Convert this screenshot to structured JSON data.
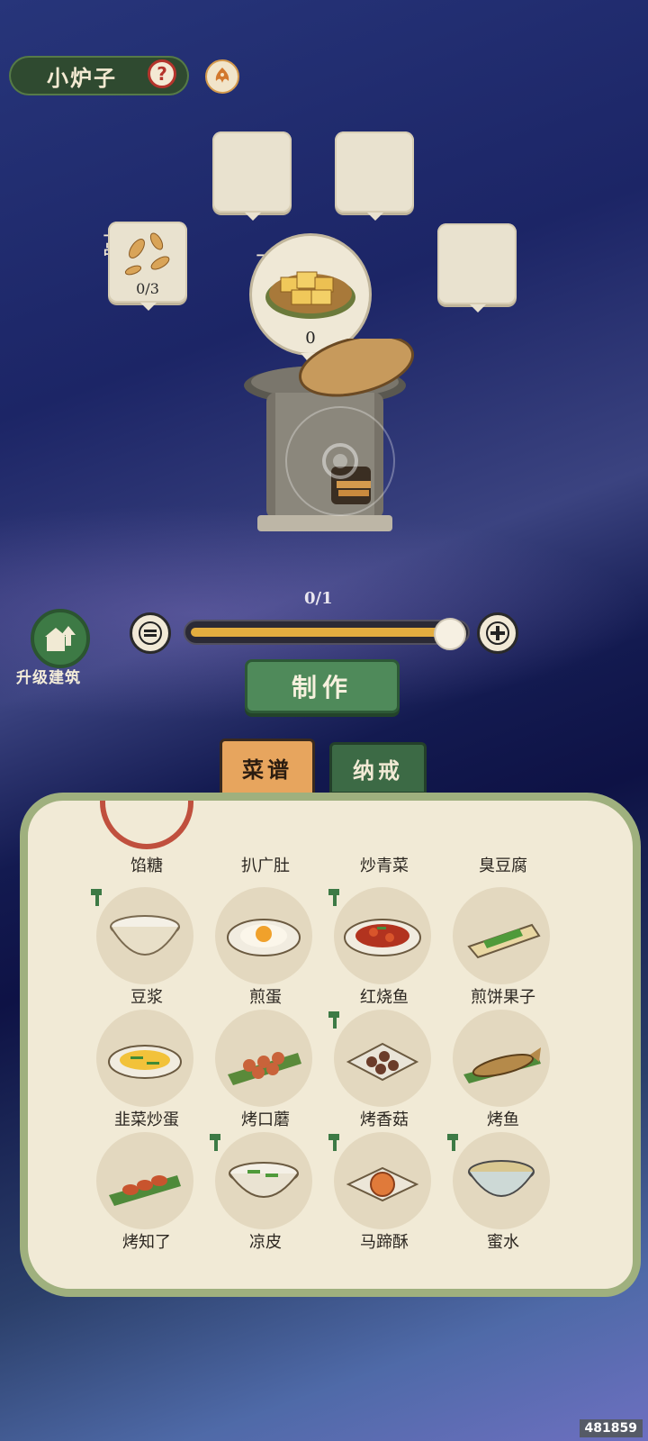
{
  "header": {
    "title": "小炉子"
  },
  "slots": [
    {
      "grade": "一品",
      "count": "0/3"
    }
  ],
  "dish": {
    "grade": "一品",
    "count": "0"
  },
  "quantity": {
    "label": "0/1",
    "fraction": 1.0
  },
  "upgrade": {
    "label": "升级建筑"
  },
  "make_button": {
    "label": "制作"
  },
  "tabs": [
    {
      "label": "菜谱",
      "active": true
    },
    {
      "label": "纳戒",
      "active": false
    }
  ],
  "recipes": {
    "top_row": [
      "馅糖",
      "扒广肚",
      "炒青菜",
      "臭豆腐"
    ],
    "items": [
      {
        "name": "豆浆",
        "locked": true,
        "icon": "bowl-soymilk-icon"
      },
      {
        "name": "煎蛋",
        "locked": false,
        "icon": "fried-egg-icon"
      },
      {
        "name": "红烧鱼",
        "locked": true,
        "icon": "braised-fish-icon"
      },
      {
        "name": "煎饼果子",
        "locked": false,
        "icon": "pancake-roll-icon"
      },
      {
        "name": "韭菜炒蛋",
        "locked": false,
        "icon": "chive-egg-icon"
      },
      {
        "name": "烤口蘑",
        "locked": false,
        "icon": "grilled-mushroom-icon"
      },
      {
        "name": "烤香菇",
        "locked": true,
        "icon": "grilled-shiitake-icon"
      },
      {
        "name": "烤鱼",
        "locked": false,
        "icon": "grilled-fish-icon"
      },
      {
        "name": "烤知了",
        "locked": false,
        "icon": "grilled-cicada-icon"
      },
      {
        "name": "凉皮",
        "locked": true,
        "icon": "cold-noodle-icon"
      },
      {
        "name": "马蹄酥",
        "locked": true,
        "icon": "horseshoe-pastry-icon"
      },
      {
        "name": "蜜水",
        "locked": true,
        "icon": "honey-water-icon"
      }
    ]
  },
  "watermark": "481859",
  "colors": {
    "accent_green": "#4f8a5a",
    "tab_orange": "#e7a55e",
    "panel_bg": "#f1ead6"
  }
}
